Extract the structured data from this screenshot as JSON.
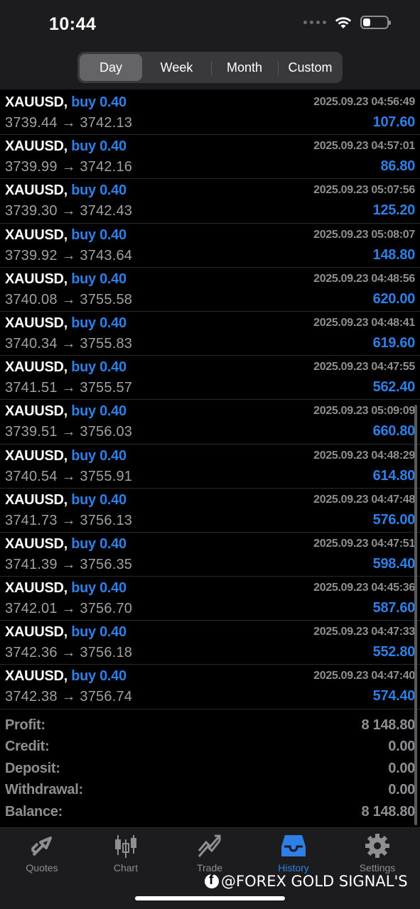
{
  "status_bar": {
    "time": "10:44"
  },
  "period_tabs": [
    {
      "label": "Day",
      "active": true
    },
    {
      "label": "Week",
      "active": false
    },
    {
      "label": "Month",
      "active": false
    },
    {
      "label": "Custom",
      "active": false
    }
  ],
  "trades": [
    {
      "symbol": "XAUUSD,",
      "type": "buy 0.40",
      "time": "2025.09.23 04:56:49",
      "prices": "3739.44 → 3742.13",
      "profit": "107.60"
    },
    {
      "symbol": "XAUUSD,",
      "type": "buy 0.40",
      "time": "2025.09.23 04:57:01",
      "prices": "3739.99 → 3742.16",
      "profit": "86.80"
    },
    {
      "symbol": "XAUUSD,",
      "type": "buy 0.40",
      "time": "2025.09.23 05:07:56",
      "prices": "3739.30 → 3742.43",
      "profit": "125.20"
    },
    {
      "symbol": "XAUUSD,",
      "type": "buy 0.40",
      "time": "2025.09.23 05:08:07",
      "prices": "3739.92 → 3743.64",
      "profit": "148.80"
    },
    {
      "symbol": "XAUUSD,",
      "type": "buy 0.40",
      "time": "2025.09.23 04:48:56",
      "prices": "3740.08 → 3755.58",
      "profit": "620.00"
    },
    {
      "symbol": "XAUUSD,",
      "type": "buy 0.40",
      "time": "2025.09.23 04:48:41",
      "prices": "3740.34 → 3755.83",
      "profit": "619.60"
    },
    {
      "symbol": "XAUUSD,",
      "type": "buy 0.40",
      "time": "2025.09.23 04:47:55",
      "prices": "3741.51 → 3755.57",
      "profit": "562.40"
    },
    {
      "symbol": "XAUUSD,",
      "type": "buy 0.40",
      "time": "2025.09.23 05:09:09",
      "prices": "3739.51 → 3756.03",
      "profit": "660.80"
    },
    {
      "symbol": "XAUUSD,",
      "type": "buy 0.40",
      "time": "2025.09.23 04:48:29",
      "prices": "3740.54 → 3755.91",
      "profit": "614.80"
    },
    {
      "symbol": "XAUUSD,",
      "type": "buy 0.40",
      "time": "2025.09.23 04:47:48",
      "prices": "3741.73 → 3756.13",
      "profit": "576.00"
    },
    {
      "symbol": "XAUUSD,",
      "type": "buy 0.40",
      "time": "2025.09.23 04:47:51",
      "prices": "3741.39 → 3756.35",
      "profit": "598.40"
    },
    {
      "symbol": "XAUUSD,",
      "type": "buy 0.40",
      "time": "2025.09.23 04:45:36",
      "prices": "3742.01 → 3756.70",
      "profit": "587.60"
    },
    {
      "symbol": "XAUUSD,",
      "type": "buy 0.40",
      "time": "2025.09.23 04:47:33",
      "prices": "3742.36 → 3756.18",
      "profit": "552.80"
    },
    {
      "symbol": "XAUUSD,",
      "type": "buy 0.40",
      "time": "2025.09.23 04:47:40",
      "prices": "3742.38 → 3756.74",
      "profit": "574.40"
    }
  ],
  "summary": [
    {
      "label": "Profit:",
      "value": "8 148.80"
    },
    {
      "label": "Credit:",
      "value": "0.00"
    },
    {
      "label": "Deposit:",
      "value": "0.00"
    },
    {
      "label": "Withdrawal:",
      "value": "0.00"
    },
    {
      "label": "Balance:",
      "value": "8 148.80"
    }
  ],
  "tabbar": [
    {
      "label": "Quotes",
      "icon": "quotes-icon",
      "active": false
    },
    {
      "label": "Chart",
      "icon": "chart-icon",
      "active": false
    },
    {
      "label": "Trade",
      "icon": "trade-icon",
      "active": false
    },
    {
      "label": "History",
      "icon": "history-icon",
      "active": true
    },
    {
      "label": "Settings",
      "icon": "settings-icon",
      "active": false
    }
  ],
  "watermark": "@FOREX GOLD SIGNAL'S ",
  "colors": {
    "accent": "#2f7fe8",
    "muted": "#8e8e93",
    "background": "#000000",
    "bar": "#1c1c1e"
  }
}
